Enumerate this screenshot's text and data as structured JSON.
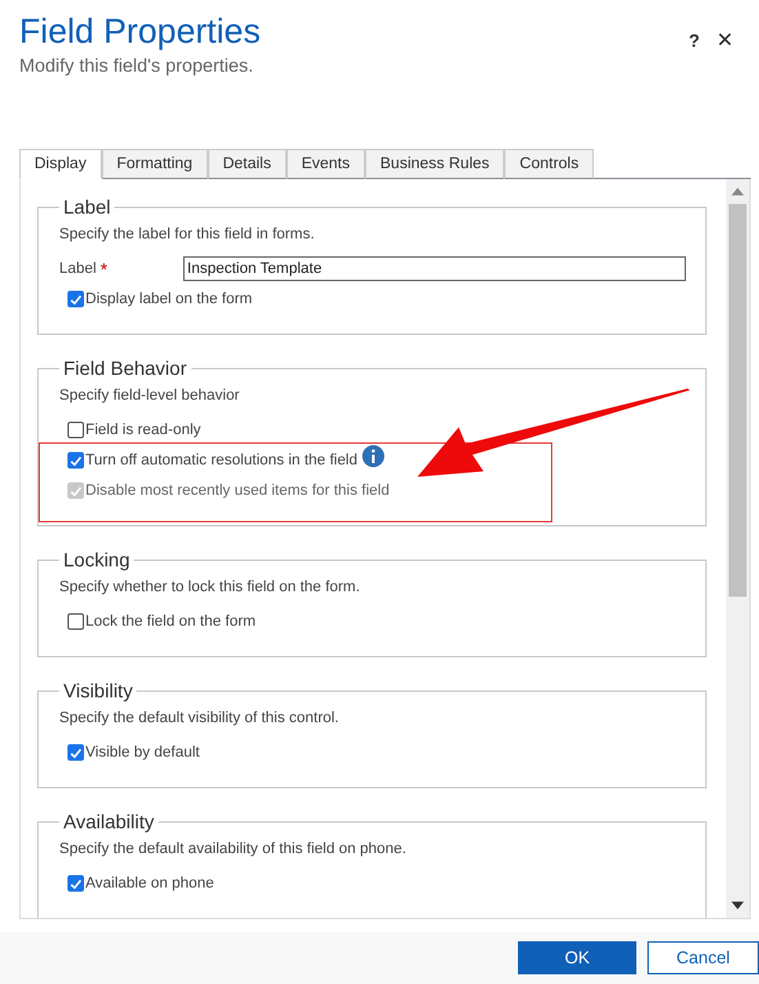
{
  "dialog": {
    "title": "Field Properties",
    "subtitle": "Modify this field's properties.",
    "help": "?",
    "close": "✕"
  },
  "tabs": [
    {
      "label": "Display",
      "selected": true
    },
    {
      "label": "Formatting",
      "selected": false
    },
    {
      "label": "Details",
      "selected": false
    },
    {
      "label": "Events",
      "selected": false
    },
    {
      "label": "Business Rules",
      "selected": false
    },
    {
      "label": "Controls",
      "selected": false
    }
  ],
  "sections": [
    {
      "legend": "Label",
      "description": "Specify the label for this field in forms.",
      "items": [
        {
          "kind": "field",
          "label": "Label",
          "required_mark": "*",
          "value": "Inspection Template"
        },
        {
          "kind": "checkbox",
          "label": "Display label on the form",
          "checked": true,
          "disabled": false
        }
      ]
    },
    {
      "legend": "Field Behavior",
      "description": "Specify field-level behavior",
      "items": [
        {
          "kind": "checkbox",
          "label": "Field is read-only",
          "checked": false,
          "disabled": false
        },
        {
          "kind": "checkbox",
          "label": "Turn off automatic resolutions in the field",
          "checked": true,
          "disabled": false,
          "info": true
        },
        {
          "kind": "checkbox",
          "label": "Disable most recently used items for this field",
          "checked": true,
          "disabled": true
        }
      ]
    },
    {
      "legend": "Locking",
      "description": "Specify whether to lock this field on the form.",
      "items": [
        {
          "kind": "checkbox",
          "label": "Lock the field on the form",
          "checked": false,
          "disabled": false
        }
      ]
    },
    {
      "legend": "Visibility",
      "description": "Specify the default visibility of this control.",
      "items": [
        {
          "kind": "checkbox",
          "label": "Visible by default",
          "checked": true,
          "disabled": false
        }
      ]
    },
    {
      "legend": "Availability",
      "description": "Specify the default availability of this field on phone.",
      "items": [
        {
          "kind": "checkbox",
          "label": "Available on phone",
          "checked": true,
          "disabled": false
        }
      ]
    }
  ],
  "buttons": [
    {
      "label": "OK",
      "kind": "primary"
    },
    {
      "label": "Cancel",
      "kind": "secondary"
    }
  ]
}
